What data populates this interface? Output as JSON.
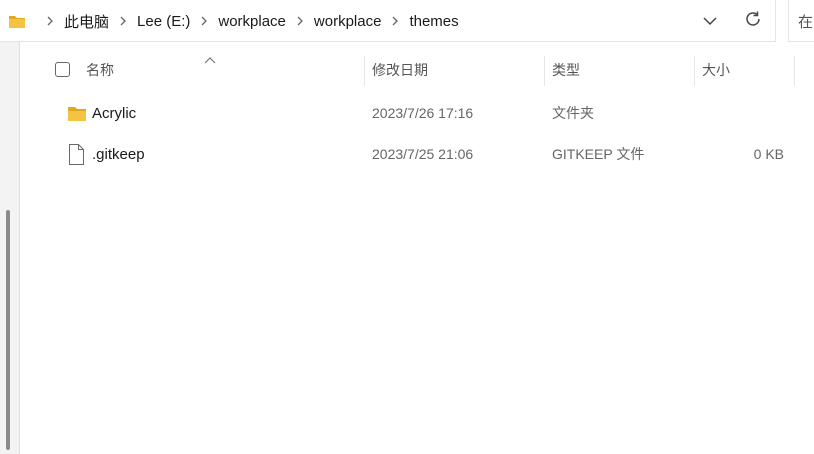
{
  "address_bar": {
    "breadcrumbs": [
      "此电脑",
      "Lee (E:)",
      "workplace",
      "workplace",
      "themes"
    ]
  },
  "search": {
    "placeholder": "在"
  },
  "columns": {
    "name": "名称",
    "modified": "修改日期",
    "type": "类型",
    "size": "大小"
  },
  "files": [
    {
      "name": "Acrylic",
      "modified": "2023/7/26 17:16",
      "type": "文件夹",
      "size": "",
      "icon": "folder-icon"
    },
    {
      "name": ".gitkeep",
      "modified": "2023/7/25 21:06",
      "type": "GITKEEP 文件",
      "size": "0 KB",
      "icon": "file-icon"
    }
  ],
  "colors": {
    "folder": "#f5c342",
    "folder_dark": "#e0a820"
  }
}
